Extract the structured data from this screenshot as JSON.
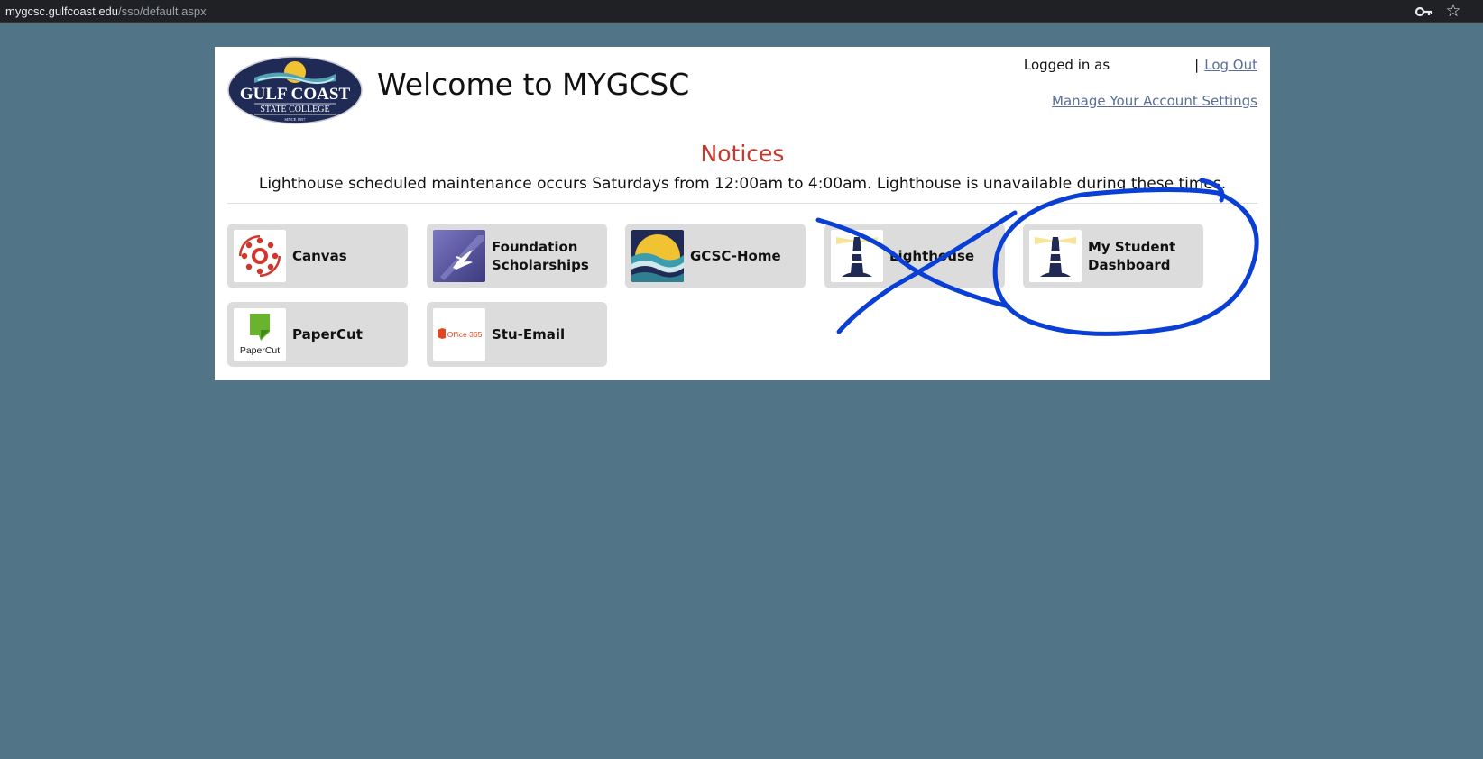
{
  "browser": {
    "url_host": "mygcsc.gulfcoast.edu",
    "url_path": "/sso/default.aspx",
    "key_icon": "key-icon",
    "star_icon": "star-icon"
  },
  "header": {
    "logo_text_top": "GULF COAST",
    "logo_text_bottom": "STATE COLLEGE",
    "logo_since": "SINCE 1957",
    "welcome": "Welcome to MYGCSC",
    "logged_in_label": "Logged in as",
    "separator": "|",
    "logout": "Log Out",
    "manage_settings": "Manage Your Account Settings"
  },
  "notices": {
    "title": "Notices",
    "text": "Lighthouse scheduled maintenance occurs Saturdays from 12:00am to 4:00am. Lighthouse is unavailable during these times."
  },
  "apps": [
    {
      "label": "Canvas",
      "icon": "canvas-icon"
    },
    {
      "label": "Foundation Scholarships",
      "icon": "foundation-icon"
    },
    {
      "label": "GCSC-Home",
      "icon": "gcsc-home-icon"
    },
    {
      "label": "Lighthouse",
      "icon": "lighthouse-icon"
    },
    {
      "label": "My Student Dashboard",
      "icon": "lighthouse-icon"
    },
    {
      "label": "PaperCut",
      "icon": "papercut-icon",
      "icon_text": "PaperCut"
    },
    {
      "label": "Stu-Email",
      "icon": "office365-icon",
      "icon_text": "Office 365"
    }
  ],
  "colors": {
    "page_bg": "#517486",
    "notice_title": "#c8372d",
    "link": "#5b6e9a",
    "tile_bg": "#dcdcdc",
    "annotation_ink": "#0a3fd6"
  }
}
